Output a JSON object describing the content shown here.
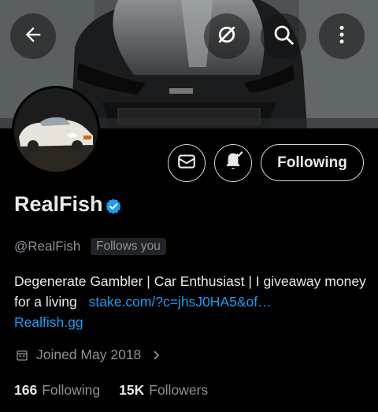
{
  "header": {
    "back_icon": "arrow-left-icon",
    "actions": [
      "notifications-off-icon",
      "search-icon",
      "more-vertical-icon"
    ]
  },
  "profile": {
    "name": "RealFish",
    "verified": true,
    "handle": "@RealFish",
    "follows_you": "Follows you",
    "bio_text": "Degenerate Gambler | Car Enthusiast | I giveaway money for a living",
    "bio_link": "stake.com/?c=jhsJ0HA5&of…",
    "bio_link2": "Realfish.gg",
    "joined": "Joined May 2018",
    "following_count": "166",
    "following_label": "Following",
    "followers_count": "15K",
    "followers_label": "Followers"
  },
  "actions": {
    "follow_label": "Following"
  },
  "colors": {
    "accent": "#1d9bf0",
    "background": "#000000",
    "secondary_text": "#8b9298"
  }
}
